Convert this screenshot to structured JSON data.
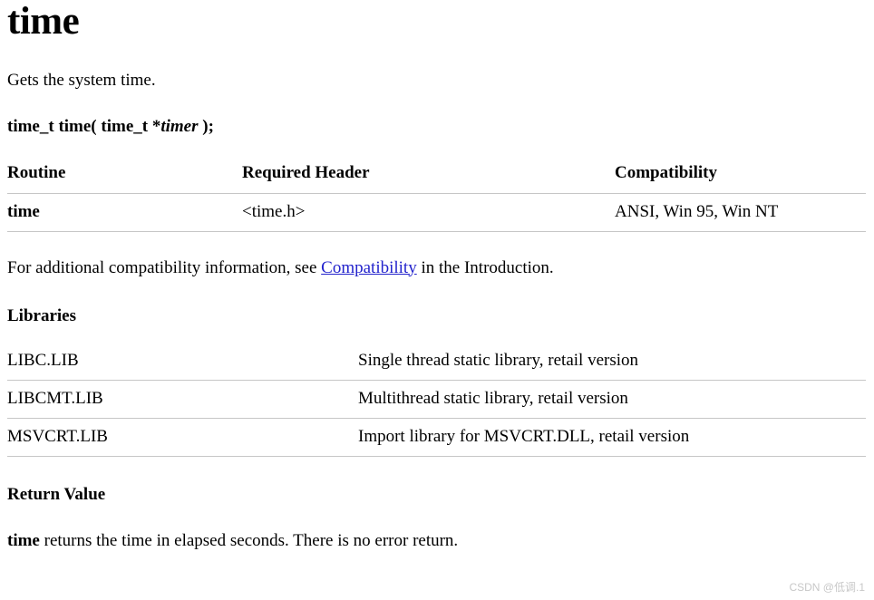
{
  "document": {
    "title": "time",
    "description": "Gets the system time.",
    "signature": {
      "prefix": "time_t time( time_t *",
      "param": "timer",
      "suffix": " );"
    }
  },
  "routine_table": {
    "headers": {
      "routine": "Routine",
      "required_header": "Required Header",
      "compatibility": "Compatibility"
    },
    "rows": [
      {
        "routine": "time",
        "required_header": "<time.h>",
        "compatibility": "ANSI, Win 95, Win NT"
      }
    ]
  },
  "compatibility_note": {
    "before_link": "For additional compatibility information, see ",
    "link_text": "Compatibility",
    "after_link": " in the Introduction.",
    "link_color": "#2222cc"
  },
  "libraries": {
    "heading": "Libraries",
    "rows": [
      {
        "name": "LIBC.LIB",
        "description": "Single thread static library, retail version"
      },
      {
        "name": "LIBCMT.LIB",
        "description": "Multithread static library, retail version"
      },
      {
        "name": "MSVCRT.LIB",
        "description": "Import library for MSVCRT.DLL, retail version"
      }
    ]
  },
  "return_value": {
    "heading": "Return Value",
    "emphasis": "time",
    "text": " returns the time in elapsed seconds. There is no error return."
  },
  "watermark": {
    "text": "CSDN @低调.1",
    "color": "#c8c8c8"
  }
}
